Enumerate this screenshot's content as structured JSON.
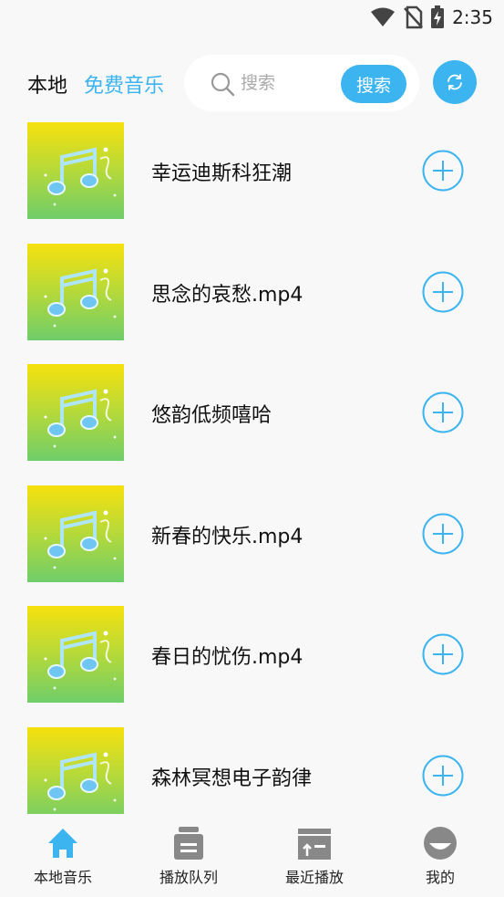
{
  "status_bar": {
    "time": "2:35",
    "icons": [
      "wifi-icon",
      "no-sim-icon",
      "battery-charging-icon"
    ]
  },
  "header": {
    "tab_local": "本地",
    "tab_free_music": "免费音乐",
    "search_placeholder": "搜索",
    "search_button": "搜索",
    "refresh_icon": "refresh-icon",
    "accent_color": "#3cb4f0"
  },
  "songs": [
    {
      "title": "幸运迪斯科狂潮"
    },
    {
      "title": "思念的哀愁.mp4"
    },
    {
      "title": "悠韵低频嘻哈"
    },
    {
      "title": "新春的快乐.mp4"
    },
    {
      "title": "春日的忧伤.mp4"
    },
    {
      "title": "森林冥想电子韵律"
    }
  ],
  "bottom_nav": {
    "items": [
      {
        "label": "本地音乐",
        "icon": "home-icon",
        "active": true
      },
      {
        "label": "播放队列",
        "icon": "queue-icon",
        "active": false
      },
      {
        "label": "最近播放",
        "icon": "recent-icon",
        "active": false
      },
      {
        "label": "我的",
        "icon": "profile-icon",
        "active": false
      }
    ]
  }
}
